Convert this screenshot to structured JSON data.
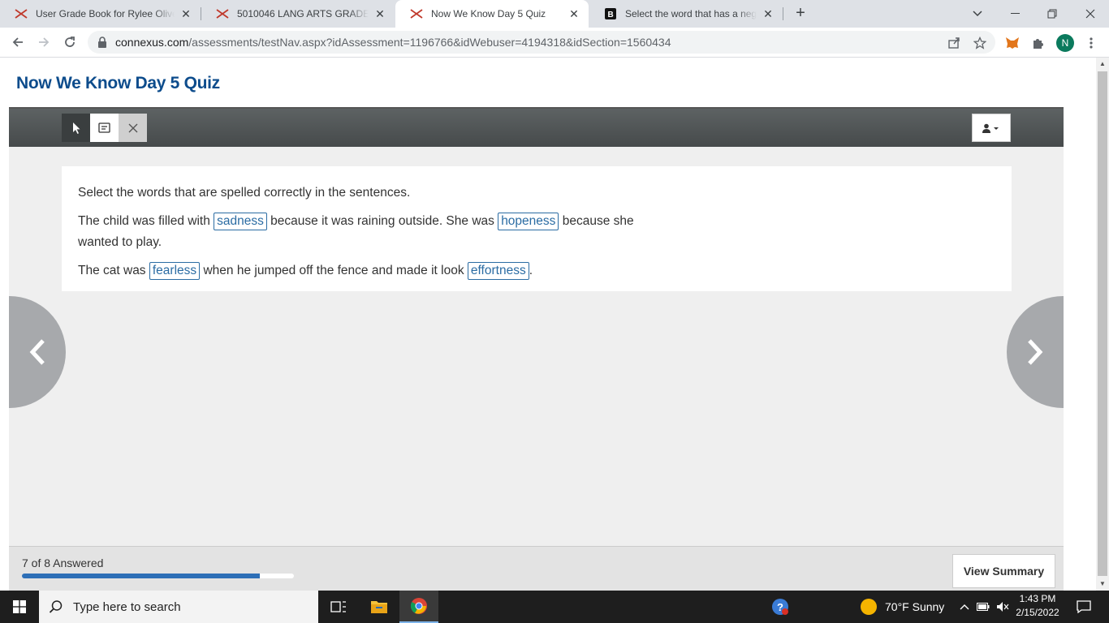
{
  "browser": {
    "tabs": [
      {
        "title": "User Grade Book for Rylee Oliver",
        "favicon": "connexus-icon"
      },
      {
        "title": "5010046 LANG ARTS GRADE 5 - ",
        "favicon": "connexus-icon"
      },
      {
        "title": "Now We Know Day 5 Quiz",
        "favicon": "connexus-icon",
        "active": true
      },
      {
        "title": "Select the word that has a negati",
        "favicon": "brainly-icon"
      }
    ],
    "url_host": "connexus.com",
    "url_path": "/assessments/testNav.aspx?idAssessment=1196766&idWebuser=4194318&idSection=1560434",
    "profile_initial": "N"
  },
  "page": {
    "title": "Now We Know Day 5 Quiz"
  },
  "question": {
    "prompt": "Select the words that are spelled correctly in the sentences.",
    "sentence1": {
      "part1": "The child was filled with ",
      "word1": "sadness",
      "part2": " because it was raining outside. She was ",
      "word2": "hopeness",
      "part3": " because she wanted to play."
    },
    "sentence2": {
      "part1": "The cat was ",
      "word1": "fearless",
      "part2": " when he jumped off the fence and made it look ",
      "word2": "effortness",
      "part3": "."
    }
  },
  "footer": {
    "answered_text": "7 of 8 Answered",
    "answered": 7,
    "total": 8,
    "view_summary": "View Summary"
  },
  "taskbar": {
    "search_placeholder": "Type here to search",
    "weather": "70°F  Sunny",
    "time": "1:43 PM",
    "date": "2/15/2022"
  },
  "colors": {
    "title_blue": "#0d4c8c",
    "word_border": "#2b6ca3",
    "progress_fill": "#2d6fb7",
    "connexus_red": "#c0392b"
  }
}
